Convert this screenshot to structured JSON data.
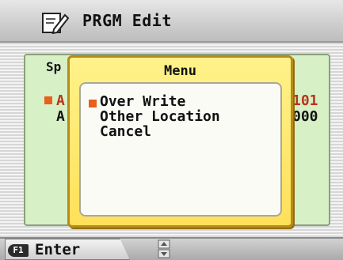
{
  "header": {
    "title": "PRGM Edit",
    "icon": "pencil-notepad-icon"
  },
  "background": {
    "tab_label": "Sp",
    "rows": [
      {
        "label": "A",
        "value": "101"
      },
      {
        "label": "A",
        "value": "000"
      }
    ]
  },
  "menu": {
    "title": "Menu",
    "options": [
      "Over Write",
      "Other Location",
      "Cancel"
    ],
    "selected_index": 0
  },
  "footer": {
    "fkey": "F1",
    "label": "Enter",
    "scroll_icon": "up-down-arrows-icon"
  },
  "colors": {
    "marker": "#e8601a",
    "menu_bg": "#ffe05a",
    "panel_bg": "#d7f0c6",
    "highlight_text": "#b8341a"
  }
}
